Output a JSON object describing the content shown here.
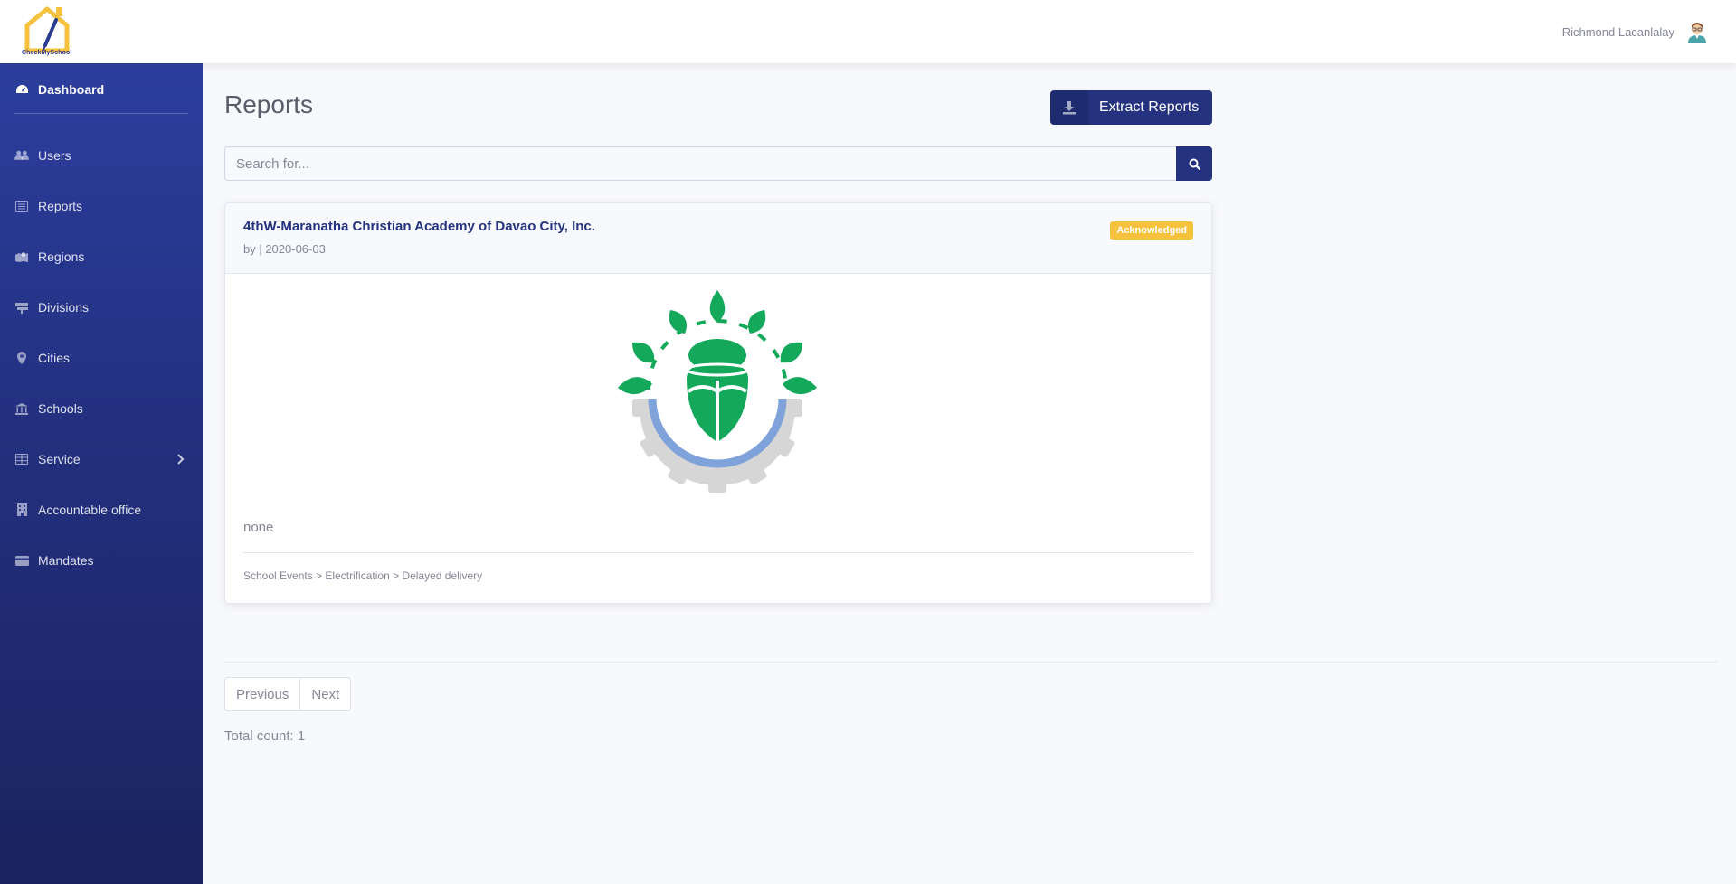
{
  "header": {
    "logo_text": "CheckMySchool",
    "user_name": "Richmond Lacanlalay"
  },
  "sidebar": {
    "items": [
      {
        "label": "Dashboard",
        "icon": "dashboard-icon",
        "active": true
      },
      {
        "label": "Users",
        "icon": "users-icon"
      },
      {
        "label": "Reports",
        "icon": "reports-icon"
      },
      {
        "label": "Regions",
        "icon": "map-icon"
      },
      {
        "label": "Divisions",
        "icon": "sign-icon"
      },
      {
        "label": "Cities",
        "icon": "map-marker-icon"
      },
      {
        "label": "Schools",
        "icon": "school-icon"
      },
      {
        "label": "Service",
        "icon": "table-icon"
      },
      {
        "label": "Accountable office",
        "icon": "building-icon"
      },
      {
        "label": "Mandates",
        "icon": "card-icon"
      }
    ]
  },
  "main": {
    "title": "Reports",
    "extract_label": "Extract Reports",
    "search": {
      "placeholder": "Search for...",
      "value": ""
    },
    "report": {
      "school": "4thW-Maranatha Christian Academy of Davao City, Inc.",
      "byline": "by | 2020-06-03",
      "status": "Acknowledged",
      "description": "none",
      "category_path": "School Events > Electrification > Delayed delivery"
    },
    "pagination": {
      "previous": "Previous",
      "next": "Next"
    },
    "total": "Total count: 1"
  },
  "colors": {
    "primary": "#24327f",
    "badge": "#f6c23e",
    "sidebar_top": "#2c3e9e",
    "sidebar_bottom": "#1b235f",
    "logo_green": "#13a85a",
    "logo_blue": "#7fa2db"
  }
}
